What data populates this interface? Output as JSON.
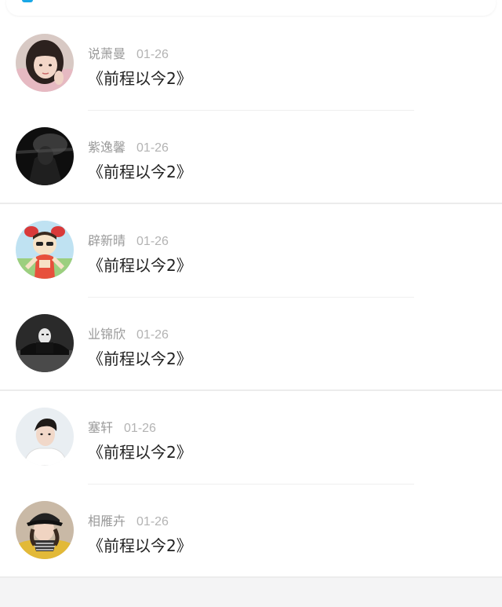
{
  "feed": {
    "items": [
      {
        "name": "说萧曼",
        "date": "01-26",
        "text": "《前程以今2》",
        "avatar": "girl-portrait-avatar"
      },
      {
        "name": "紫逸馨",
        "date": "01-26",
        "text": "《前程以今2》",
        "avatar": "dark-figure-avatar"
      },
      {
        "name": "辟新晴",
        "date": "01-26",
        "text": "《前程以今2》",
        "avatar": "cartoon-girl-avatar"
      },
      {
        "name": "业锦欣",
        "date": "01-26",
        "text": "《前程以今2》",
        "avatar": "masked-person-avatar"
      },
      {
        "name": "塞轩",
        "date": "01-26",
        "text": "《前程以今2》",
        "avatar": "young-man-avatar"
      },
      {
        "name": "相雁卉",
        "date": "01-26",
        "text": "《前程以今2》",
        "avatar": "girl-cap-scarf-avatar"
      }
    ]
  },
  "colors": {
    "accent": "#19a7e6",
    "name_text": "#9a9a9a",
    "date_text": "#b3b3b3",
    "message_text": "#222222",
    "page_bg": "#f4f4f5"
  }
}
